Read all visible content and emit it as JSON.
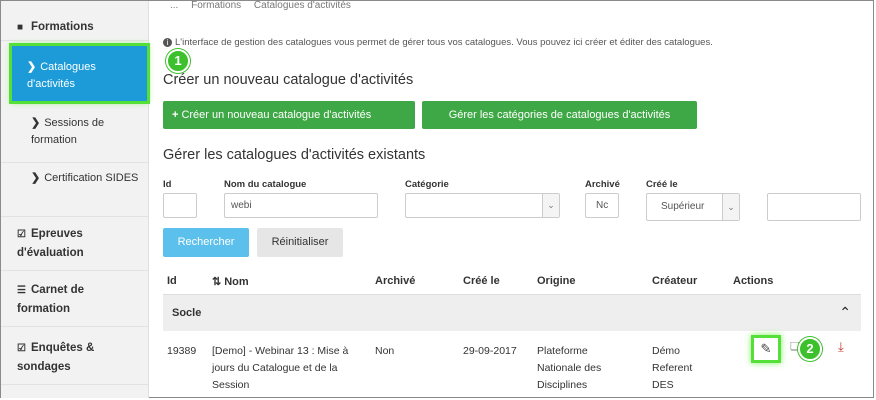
{
  "breadcrumb": [
    "...",
    "Formations",
    "Catalogues d'activités"
  ],
  "sidebar": {
    "items": [
      {
        "label": "Formations",
        "icon": "book-icon",
        "kind": "head"
      },
      {
        "label": "Catalogues d'activités",
        "icon": "chevron-right-icon",
        "kind": "sub",
        "active": true
      },
      {
        "label": "Sessions de formation",
        "icon": "chevron-right-icon",
        "kind": "sub"
      },
      {
        "label": "Certification SIDES",
        "icon": "chevron-right-icon",
        "kind": "sub"
      },
      {
        "label": "Epreuves d'évaluation",
        "icon": "checkbox-icon",
        "kind": "head"
      },
      {
        "label": "Carnet de formation",
        "icon": "list-icon",
        "kind": "head"
      },
      {
        "label": "Enquêtes & sondages",
        "icon": "checkbox-icon",
        "kind": "head"
      }
    ]
  },
  "info_text": "L'interface de gestion des catalogues vous permet de gérer tous vos catalogues. Vous pouvez ici créer et éditer des catalogues.",
  "markers": {
    "one": "1",
    "two": "2"
  },
  "create_title": "Créer un nouveau catalogue d'activités",
  "buttons": {
    "create": "Créer un nouveau catalogue d'activités",
    "categories": "Gérer les catégories de catalogues d'activités",
    "search": "Rechercher",
    "reset": "Réinitialiser"
  },
  "manage_title": "Gérer les catalogues d'activités existants",
  "filters": {
    "id_label": "Id",
    "id_value": "",
    "name_label": "Nom du catalogue",
    "name_value": "webi",
    "category_label": "Catégorie",
    "category_value": "",
    "archived_label": "Archivé",
    "archived_value": "Nc",
    "created_label": "Créé le",
    "created_select": "Supérieur",
    "created_value": ""
  },
  "table": {
    "headers": [
      "Id",
      "Nom",
      "Archivé",
      "Créé le",
      "Origine",
      "Créateur",
      "Actions"
    ],
    "group": "Socle",
    "rows": [
      {
        "id": "19389",
        "name": "[Demo] - Webinar 13 : Mise à jours du Catalogue et de la Session",
        "archived": "Non",
        "created": "29-09-2017",
        "origin": "Plateforme Nationale des Disciplines",
        "creator": "Démo Referent DES"
      }
    ]
  },
  "colors": {
    "active": "#1c9bd8",
    "green": "#3fa846",
    "highlight": "#55e039",
    "blue": "#5bc0eb"
  }
}
